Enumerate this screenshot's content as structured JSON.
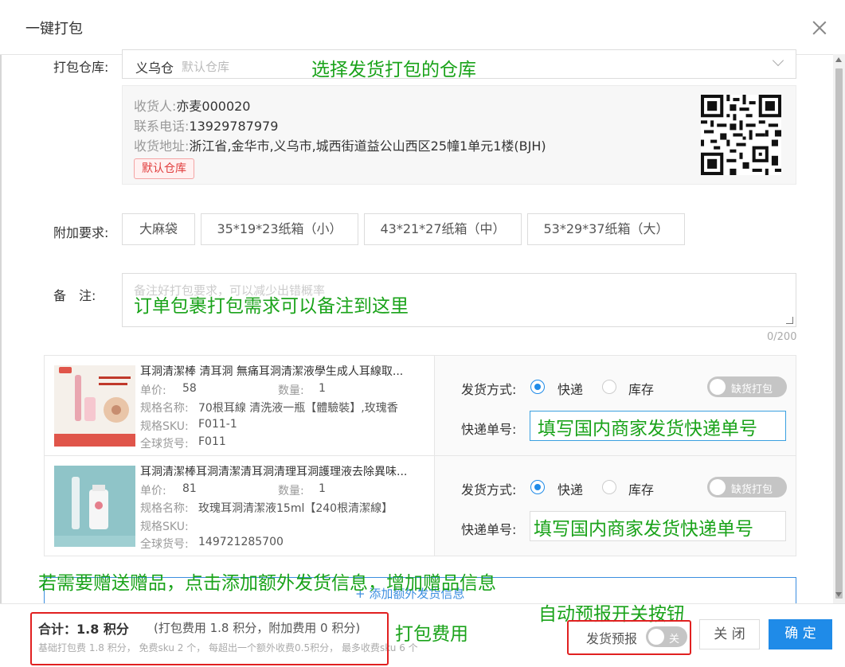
{
  "dialog": {
    "title": "一键打包"
  },
  "warehouse": {
    "label": "打包仓库:",
    "value": "义乌仓",
    "placeholder": "默认仓库",
    "annotation": "选择发货打包的仓库"
  },
  "recipient": {
    "name_label": "收货人:",
    "name": "亦麦000020",
    "phone_label": "联系电话:",
    "phone": "13929787979",
    "address_label": "收货地址:",
    "address": "浙江省,金华市,义乌市,城西街道益公山西区25幢1单元1楼(BJH)",
    "tag": "默认仓库"
  },
  "extra": {
    "label": "附加要求:",
    "options": [
      "大麻袋",
      "35*19*23纸箱（小）",
      "43*21*27纸箱（中）",
      "53*29*37纸箱（大）"
    ]
  },
  "remark": {
    "label": "备　注:",
    "placeholder": "备注好打包要求，可以减少出错概率",
    "annotation": "订单包裹打包需求可以备注到这里",
    "counter": "0/200"
  },
  "products": [
    {
      "title": "耳洞清潔棒 清耳洞 無痛耳洞清潔液學生成人耳線取...",
      "price_label": "单价:",
      "price": "58",
      "qty_label": "数量:",
      "qty": "1",
      "spec_label": "规格名称:",
      "spec": "70根耳線 清洗液一瓶【體驗裝】,玫瑰香",
      "sku_label": "规格SKU:",
      "sku": "F011-1",
      "gsku_label": "全球货号:",
      "gsku": "F011",
      "ship_label": "发货方式:",
      "opt_express": "快递",
      "opt_stock": "库存",
      "toggle": "缺货打包",
      "tracking_label": "快递单号:",
      "annotation": "填写国内商家发货快递单号"
    },
    {
      "title": "耳洞清潔棒耳洞清潔清耳洞清理耳洞護理液去除異味...",
      "price_label": "单价:",
      "price": "81",
      "qty_label": "数量:",
      "qty": "1",
      "spec_label": "规格名称:",
      "spec": "玫瑰耳洞清潔液15ml【240根清潔線】",
      "sku_label": "规格SKU:",
      "sku": "",
      "gsku_label": "全球货号:",
      "gsku": "149721285700",
      "ship_label": "发货方式:",
      "opt_express": "快递",
      "opt_stock": "库存",
      "toggle": "缺货打包",
      "tracking_label": "快递单号:",
      "annotation": "填写国内商家发货快递单号"
    }
  ],
  "gift": {
    "annotation": "若需要赠送赠品，点击添加额外发货信息，增加赠品信息",
    "add_label": "+ 添加额外发货信息"
  },
  "footer": {
    "total": "合计：1.8 积分",
    "breakdown": "(打包费用 1.8 积分，附加费用 0 积分)",
    "detail": "基础打包费 1.8 积分， 免费sku 2 个， 每超出一个额外收费0.5积分， 最多收费sku 6 个",
    "fee_annotation": "打包费用",
    "switch_annotation": "自动预报开关按钮",
    "forecast_label": "发货预报",
    "forecast_state": "关",
    "close": "关 闭",
    "confirm": "确 定"
  },
  "colors": {
    "primary": "#1f8be8",
    "annotation": "#1aa31a",
    "highlight": "#e12020"
  }
}
